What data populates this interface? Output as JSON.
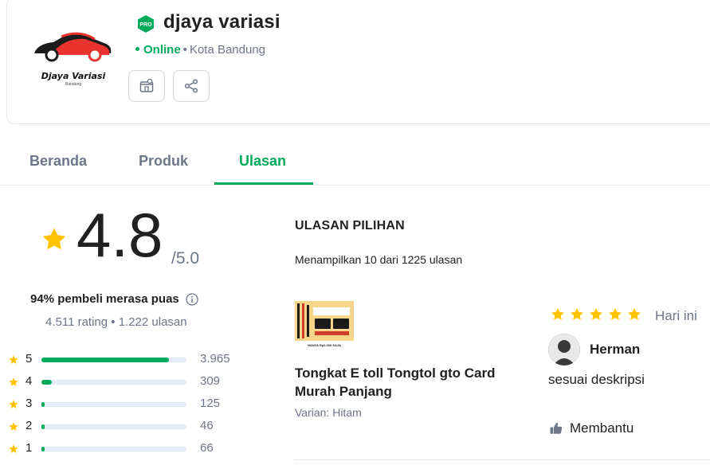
{
  "shop": {
    "logo_text": "Djaya Variasi",
    "logo_subtext": "Bandung",
    "badge": "PRO",
    "name": "djaya variasi",
    "status": "Online",
    "location": "Kota Bandung",
    "actions": [
      {
        "icon": "store-info-icon"
      },
      {
        "icon": "share-icon"
      }
    ]
  },
  "tabs": [
    {
      "label": "Beranda",
      "active": false
    },
    {
      "label": "Produk",
      "active": false
    },
    {
      "label": "Ulasan",
      "active": true
    }
  ],
  "rating": {
    "value": "4.8",
    "max": "/5.0",
    "satisfaction": "94% pembeli merasa puas",
    "counts": "4.511 rating • 1.222 ulasan",
    "distribution": [
      {
        "stars": "5",
        "count": "3.965",
        "fraction": 0.879
      },
      {
        "stars": "4",
        "count": "309",
        "fraction": 0.07
      },
      {
        "stars": "3",
        "count": "125",
        "fraction": 0.02
      },
      {
        "stars": "2",
        "count": "46",
        "fraction": 0.01
      },
      {
        "stars": "1",
        "count": "66",
        "fraction": 0.01
      }
    ]
  },
  "reviews": {
    "heading": "ULASAN PILIHAN",
    "summary": "Menampilkan 10 dari 1225 ulasan",
    "items": [
      {
        "product_title": "Tongkat E toll Tongtol gto Card Murah Panjang",
        "variant": "Varian: Hitam",
        "thumb_caption": "HANYA Rp2.000 SAJA",
        "stars": 5,
        "time": "Hari ini",
        "reviewer": "Herman",
        "text": "sesuai deskripsi",
        "helpful_label": "Membantu"
      }
    ]
  },
  "colors": {
    "accent": "#00aa5b",
    "star": "#ffc400",
    "muted": "#6d7588",
    "text": "#212121",
    "logo_red": "#e8332f"
  }
}
